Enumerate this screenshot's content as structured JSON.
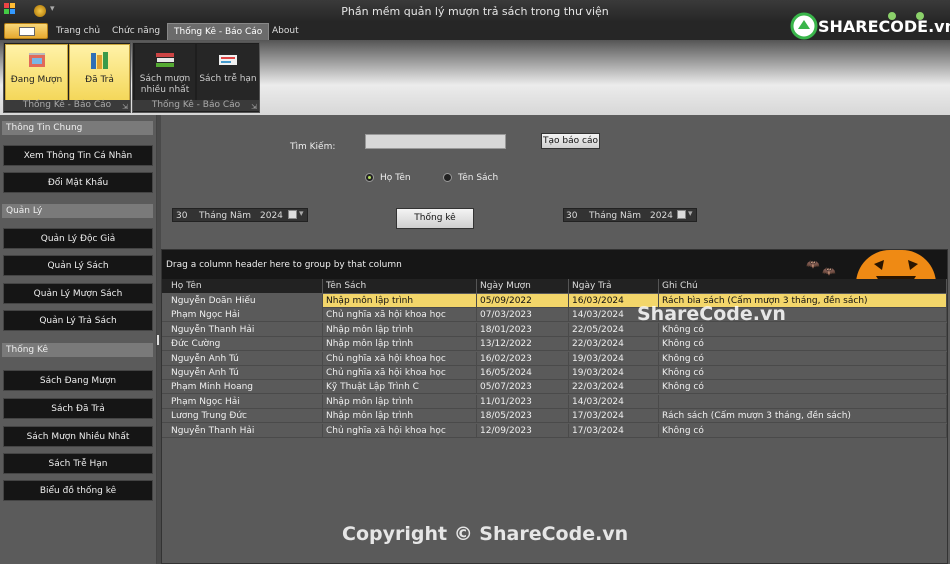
{
  "window": {
    "title": "Phần mềm quản lý mượn trả sách trong thư viện"
  },
  "tabs": [
    "Trang chủ",
    "Chức năng",
    "Thống Kê - Báo Cáo",
    "About"
  ],
  "ribbon": {
    "group1": {
      "label": "Thống Kê - Báo Cáo",
      "buttons": [
        "Đang Mượn",
        "Đã Trả"
      ]
    },
    "group2": {
      "label": "Thống Kê - Báo Cáo",
      "buttons": [
        "Sách mượn nhiều nhất",
        "Sách trễ hạn"
      ]
    }
  },
  "sidebar": {
    "sections": [
      {
        "title": "Thông Tin Chung",
        "items": [
          "Xem Thông Tin Cá Nhân",
          "Đổi Mật Khẩu"
        ]
      },
      {
        "title": "Quản Lý",
        "items": [
          "Quản Lý Độc Giả",
          "Quản Lý Sách",
          "Quản Lý Mượn Sách",
          "Quản Lý Trả Sách"
        ]
      },
      {
        "title": "Thống Kê",
        "items": [
          "Sách Đang Mượn",
          "Sách Đã Trả",
          "Sách Mượn Nhiều Nhất",
          "Sách Trễ Hạn",
          "Biểu đồ thống kê"
        ]
      }
    ]
  },
  "search": {
    "label": "Tìm Kiếm:",
    "value": "",
    "report_button": "Tạo báo cáo"
  },
  "radios": {
    "name": "Họ Tên",
    "book": "Tên Sách",
    "selected": "name"
  },
  "dates": {
    "from": {
      "day": "30",
      "mid": "Tháng Năm",
      "year": "2024"
    },
    "to": {
      "day": "30",
      "mid": "Tháng Năm",
      "year": "2024"
    }
  },
  "stats_button": "Thống kê",
  "grid": {
    "group_hint": "Drag a column header here to group by that column",
    "columns": [
      "Họ Tên",
      "Tên Sách",
      "Ngày Mượn",
      "Ngày Trả",
      "Ghi Chú"
    ],
    "rows": [
      [
        "Nguyễn Doãn Hiếu",
        "Nhập môn lập trình",
        "05/09/2022",
        "16/03/2024",
        "Rách bìa sách (Cấm mượn 3 tháng, đền sách)"
      ],
      [
        "Phạm Ngọc Hải",
        "Chủ nghĩa xã hội khoa học",
        "07/03/2023",
        "14/03/2024",
        ""
      ],
      [
        "Nguyễn Thanh Hải",
        "Nhập môn lập trình",
        "18/01/2023",
        "22/05/2024",
        "Không có"
      ],
      [
        "Đức Cường",
        "Nhập môn lập trình",
        "13/12/2022",
        "22/03/2024",
        "Không có"
      ],
      [
        "Nguyễn Anh Tú",
        "Chủ nghĩa xã hội khoa học",
        "16/02/2023",
        "19/03/2024",
        "Không có"
      ],
      [
        "Nguyễn Anh Tú",
        "Chủ nghĩa xã hội khoa học",
        "16/05/2024",
        "19/03/2024",
        "Không có"
      ],
      [
        "Phạm Minh Hoang",
        "Kỹ Thuật Lập Trình C",
        "05/07/2023",
        "22/03/2024",
        "Không có"
      ],
      [
        "Phạm Ngọc Hải",
        "Nhập môn lập trình",
        "11/01/2023",
        "14/03/2024",
        ""
      ],
      [
        "Lương Trung Đức",
        "Nhập môn lập trình",
        "18/05/2023",
        "17/03/2024",
        "Rách sách (Cấm mượn 3 tháng, đền sách)"
      ],
      [
        "Nguyễn Thanh Hải",
        "Chủ nghĩa xã hội khoa học",
        "12/09/2023",
        "17/03/2024",
        "Không có"
      ]
    ]
  },
  "watermarks": {
    "logo": "SHARECODE.vn",
    "grid": "ShareCode.vn",
    "footer": "Copyright © ShareCode.vn"
  },
  "colors": {
    "selected_row": "#f3d66a",
    "logo_green": "#39b54a"
  }
}
